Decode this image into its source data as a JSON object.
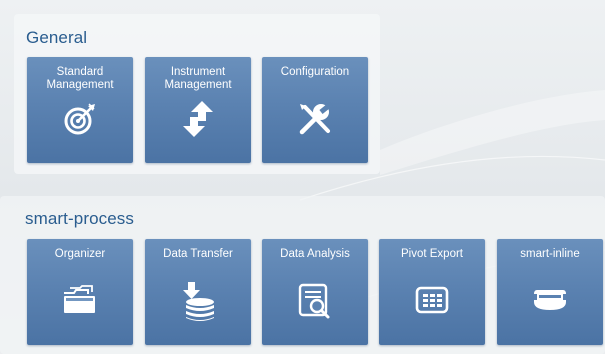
{
  "groups": {
    "general": {
      "title": "General",
      "tiles": [
        {
          "line1": "Standard",
          "line2": "Management",
          "icon": "target-icon"
        },
        {
          "line1": "Instrument",
          "line2": "Management",
          "icon": "transfer-arrows-icon"
        },
        {
          "line1": "Configuration",
          "line2": "",
          "icon": "tools-icon"
        }
      ]
    },
    "smart_process": {
      "title": "smart-process",
      "tiles": [
        {
          "label": "Organizer",
          "icon": "folder-icon"
        },
        {
          "label": "Data Transfer",
          "icon": "download-database-icon"
        },
        {
          "label": "Data Analysis",
          "icon": "report-search-icon"
        },
        {
          "label": "Pivot Export",
          "icon": "table-grid-icon"
        },
        {
          "label": "smart-inline",
          "icon": "inline-device-icon"
        }
      ]
    }
  },
  "colors": {
    "tile_top": "#6a90bc",
    "tile_bottom": "#4b73a4",
    "group_title": "#2a5d8f"
  }
}
